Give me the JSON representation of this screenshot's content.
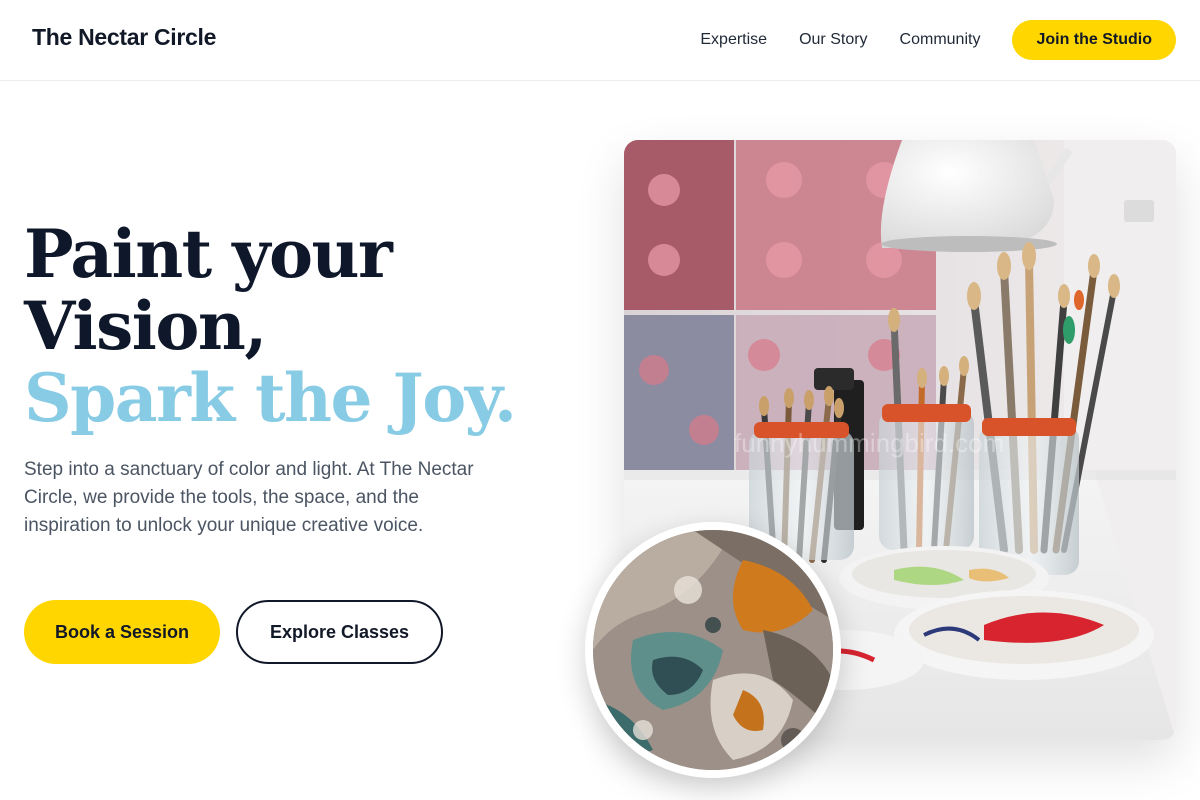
{
  "header": {
    "brand": "The Nectar Circle",
    "nav": [
      {
        "label": "Expertise"
      },
      {
        "label": "Our Story"
      },
      {
        "label": "Community"
      }
    ],
    "cta_label": "Join the Studio"
  },
  "hero": {
    "title_line1": "Paint your",
    "title_line2": "Vision,",
    "title_line3": "Spark the Joy.",
    "description": "Step into a sanctuary of color and light. At The Nectar Circle, we provide the tools, the space, and the inspiration to unlock your unique creative voice.",
    "primary_button": "Book a Session",
    "secondary_button": "Explore Classes",
    "image_watermark": "funnyhummingbird.com"
  },
  "colors": {
    "accent_yellow": "#ffd600",
    "accent_blue": "#87cbe5",
    "heading": "#0f172a",
    "body_text": "#4b5563"
  }
}
